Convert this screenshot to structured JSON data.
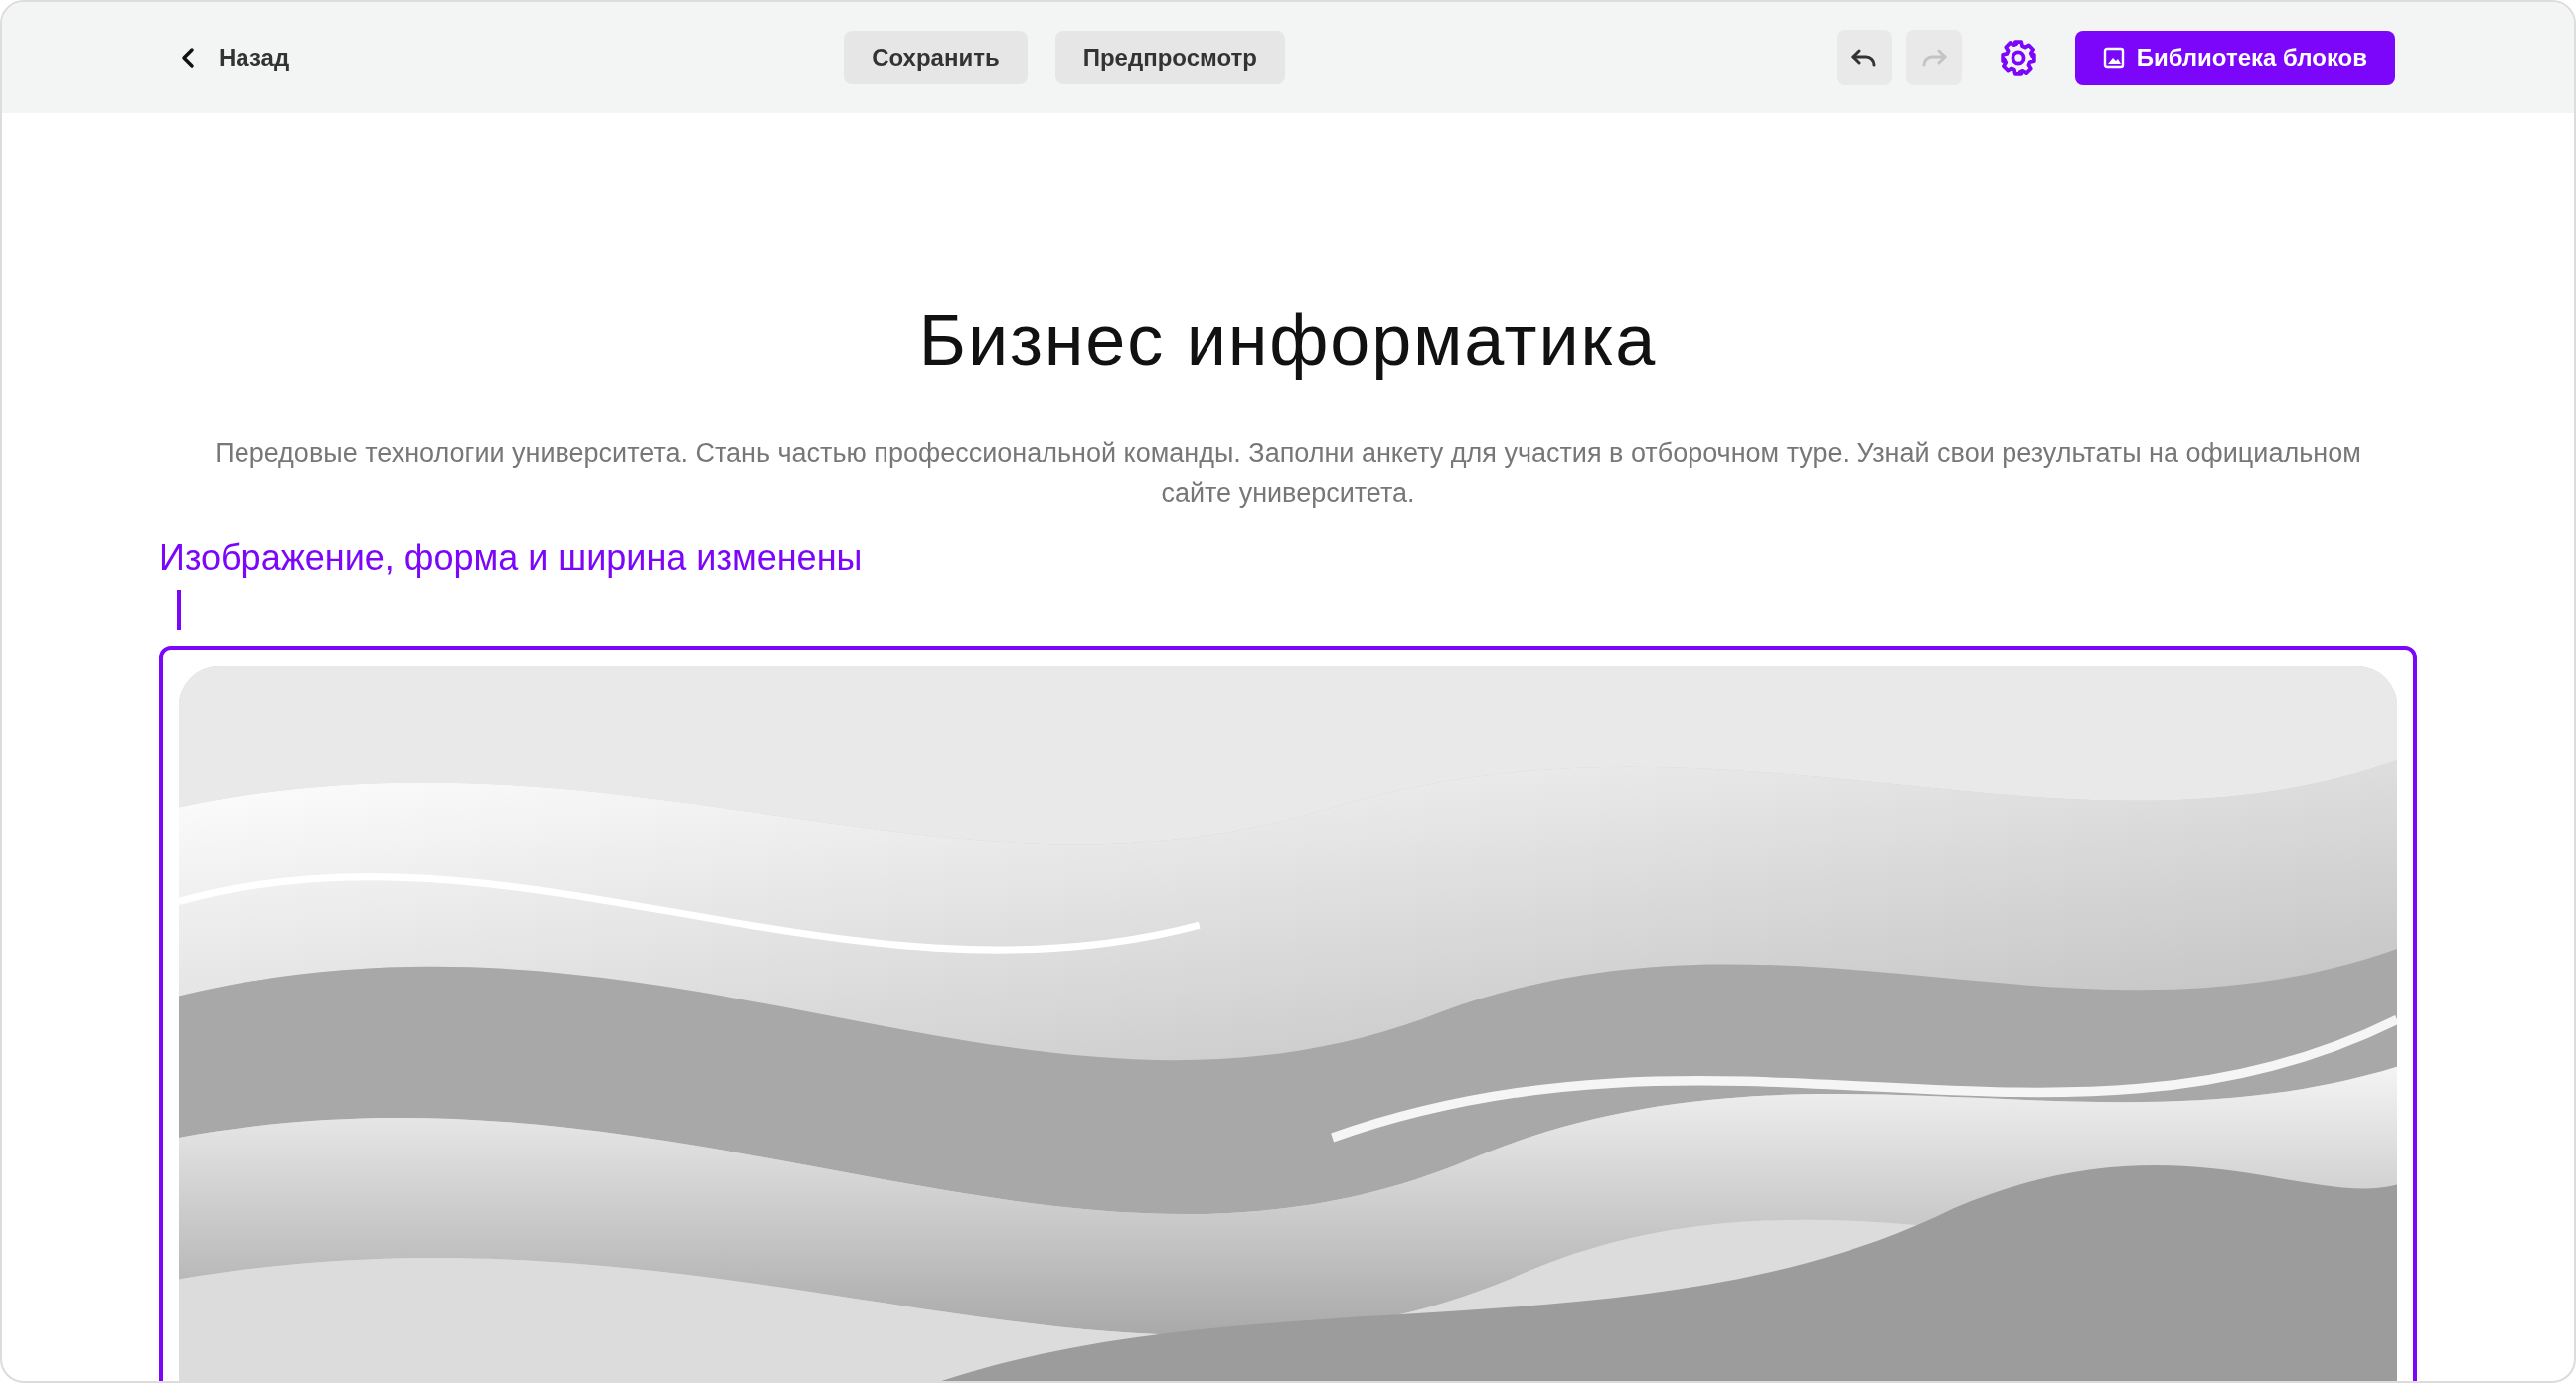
{
  "toolbar": {
    "back": {
      "label": "Назад"
    },
    "buttons": [
      {
        "label": "Сохранить"
      },
      {
        "label": "Предпросмотр"
      }
    ],
    "history": [
      {
        "kind": "undo",
        "disabled": false
      },
      {
        "kind": "redo",
        "disabled": true
      }
    ],
    "library_button": {
      "label": "Библиотека блоков"
    }
  },
  "page": {
    "title": "Бизнес информатика",
    "description": "Передовые технологии университета. Стань частью профессиональной команды. Заполни анкету для участия в отборочном туре. Узнай свои результаты на официальном сайте университета.",
    "annotation": "Изображение, форма и ширина изменены",
    "image": {
      "kind": "picture",
      "selected": true
    }
  }
}
